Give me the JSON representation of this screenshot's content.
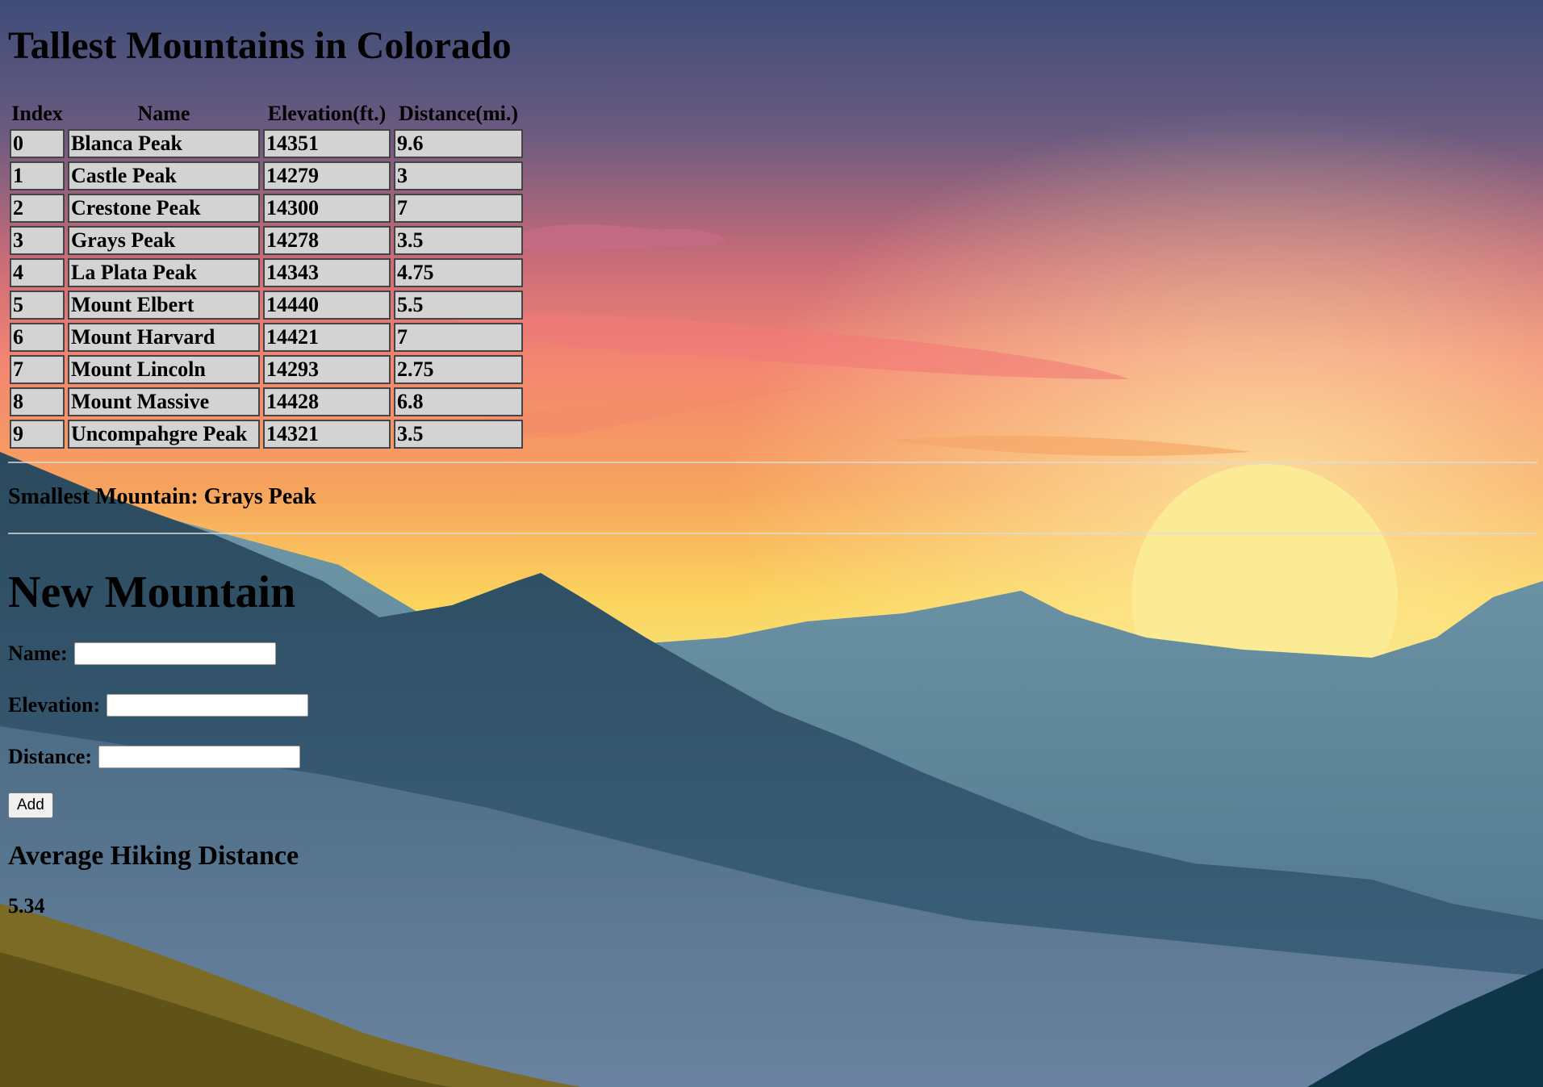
{
  "page": {
    "title": "Tallest Mountains in Colorado"
  },
  "table": {
    "headers": [
      "Index",
      "Name",
      "Elevation(ft.)",
      "Distance(mi.)"
    ],
    "rows": [
      {
        "index": "0",
        "name": "Blanca Peak",
        "elevation": "14351",
        "distance": "9.6"
      },
      {
        "index": "1",
        "name": "Castle Peak",
        "elevation": "14279",
        "distance": "3"
      },
      {
        "index": "2",
        "name": "Crestone Peak",
        "elevation": "14300",
        "distance": "7"
      },
      {
        "index": "3",
        "name": "Grays Peak",
        "elevation": "14278",
        "distance": "3.5"
      },
      {
        "index": "4",
        "name": "La Plata Peak",
        "elevation": "14343",
        "distance": "4.75"
      },
      {
        "index": "5",
        "name": "Mount Elbert",
        "elevation": "14440",
        "distance": "5.5"
      },
      {
        "index": "6",
        "name": "Mount Harvard",
        "elevation": "14421",
        "distance": "7"
      },
      {
        "index": "7",
        "name": "Mount Lincoln",
        "elevation": "14293",
        "distance": "2.75"
      },
      {
        "index": "8",
        "name": "Mount Massive",
        "elevation": "14428",
        "distance": "6.8"
      },
      {
        "index": "9",
        "name": "Uncompahgre Peak",
        "elevation": "14321",
        "distance": "3.5"
      }
    ]
  },
  "smallest": {
    "text": "Smallest Mountain: Grays Peak"
  },
  "form": {
    "heading": "New Mountain",
    "name_label": "Name:",
    "name_value": "",
    "elevation_label": "Elevation:",
    "elevation_value": "",
    "distance_label": "Distance:",
    "distance_value": "",
    "add_label": "Add"
  },
  "average": {
    "heading": "Average Hiking Distance",
    "value": "5.34"
  },
  "colors": {
    "sky_top": "#3f4e78",
    "sky_mid": "#f08070",
    "sky_low": "#f9d45c",
    "sun": "#fbe98a",
    "mountains_far": "#4f7a90",
    "mountains_mid": "#2e4d62",
    "foreground_hill": "#7a6a22",
    "cell_bg": "#d3d3d3"
  }
}
